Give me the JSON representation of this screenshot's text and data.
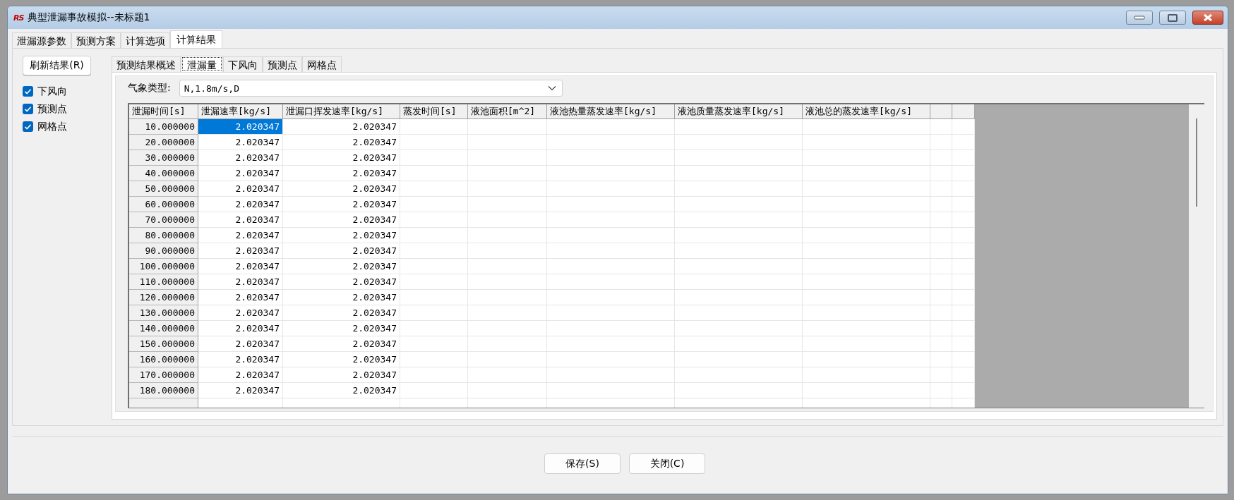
{
  "window": {
    "logo": "RS",
    "title": "典型泄漏事故模拟--未标题1"
  },
  "tabs": [
    {
      "label": "泄漏源参数",
      "selected": false
    },
    {
      "label": "预测方案",
      "selected": false
    },
    {
      "label": "计算选项",
      "selected": false
    },
    {
      "label": "计算结果",
      "selected": true
    }
  ],
  "sidebar": {
    "refresh_button": "刷新结果(R)",
    "items": [
      {
        "label": "下风向",
        "checked": true
      },
      {
        "label": "预测点",
        "checked": true
      },
      {
        "label": "网格点",
        "checked": true
      }
    ]
  },
  "result_tabs": [
    {
      "label": "预测结果概述",
      "selected": false
    },
    {
      "label": "泄漏量",
      "selected": true
    },
    {
      "label": "下风向",
      "selected": false
    },
    {
      "label": "预测点",
      "selected": false
    },
    {
      "label": "网格点",
      "selected": false
    }
  ],
  "weather": {
    "label": "气象类型:",
    "value": "N,1.8m/s,D"
  },
  "table": {
    "columns": [
      "泄漏时间[s]",
      "泄漏速率[kg/s]",
      "泄漏口挥发速率[kg/s]",
      "蒸发时间[s]",
      "液池面积[m^2]",
      "液池热量蒸发速率[kg/s]",
      "液池质量蒸发速率[kg/s]",
      "液池总的蒸发速率[kg/s]"
    ],
    "rows": [
      {
        "cells": [
          {
            "text": "10.000000",
            "selected": false
          },
          {
            "text": "2.020347",
            "selected": true
          },
          {
            "text": "2.020347",
            "selected": false
          }
        ]
      },
      {
        "cells": [
          {
            "text": "20.000000",
            "selected": false
          },
          {
            "text": "2.020347",
            "selected": false
          },
          {
            "text": "2.020347",
            "selected": false
          }
        ]
      },
      {
        "cells": [
          {
            "text": "30.000000",
            "selected": false
          },
          {
            "text": "2.020347",
            "selected": false
          },
          {
            "text": "2.020347",
            "selected": false
          }
        ]
      },
      {
        "cells": [
          {
            "text": "40.000000",
            "selected": false
          },
          {
            "text": "2.020347",
            "selected": false
          },
          {
            "text": "2.020347",
            "selected": false
          }
        ]
      },
      {
        "cells": [
          {
            "text": "50.000000",
            "selected": false
          },
          {
            "text": "2.020347",
            "selected": false
          },
          {
            "text": "2.020347",
            "selected": false
          }
        ]
      },
      {
        "cells": [
          {
            "text": "60.000000",
            "selected": false
          },
          {
            "text": "2.020347",
            "selected": false
          },
          {
            "text": "2.020347",
            "selected": false
          }
        ]
      },
      {
        "cells": [
          {
            "text": "70.000000",
            "selected": false
          },
          {
            "text": "2.020347",
            "selected": false
          },
          {
            "text": "2.020347",
            "selected": false
          }
        ]
      },
      {
        "cells": [
          {
            "text": "80.000000",
            "selected": false
          },
          {
            "text": "2.020347",
            "selected": false
          },
          {
            "text": "2.020347",
            "selected": false
          }
        ]
      },
      {
        "cells": [
          {
            "text": "90.000000",
            "selected": false
          },
          {
            "text": "2.020347",
            "selected": false
          },
          {
            "text": "2.020347",
            "selected": false
          }
        ]
      },
      {
        "cells": [
          {
            "text": "100.000000",
            "selected": false
          },
          {
            "text": "2.020347",
            "selected": false
          },
          {
            "text": "2.020347",
            "selected": false
          }
        ]
      },
      {
        "cells": [
          {
            "text": "110.000000",
            "selected": false
          },
          {
            "text": "2.020347",
            "selected": false
          },
          {
            "text": "2.020347",
            "selected": false
          }
        ]
      },
      {
        "cells": [
          {
            "text": "120.000000",
            "selected": false
          },
          {
            "text": "2.020347",
            "selected": false
          },
          {
            "text": "2.020347",
            "selected": false
          }
        ]
      },
      {
        "cells": [
          {
            "text": "130.000000",
            "selected": false
          },
          {
            "text": "2.020347",
            "selected": false
          },
          {
            "text": "2.020347",
            "selected": false
          }
        ]
      },
      {
        "cells": [
          {
            "text": "140.000000",
            "selected": false
          },
          {
            "text": "2.020347",
            "selected": false
          },
          {
            "text": "2.020347",
            "selected": false
          }
        ]
      },
      {
        "cells": [
          {
            "text": "150.000000",
            "selected": false
          },
          {
            "text": "2.020347",
            "selected": false
          },
          {
            "text": "2.020347",
            "selected": false
          }
        ]
      },
      {
        "cells": [
          {
            "text": "160.000000",
            "selected": false
          },
          {
            "text": "2.020347",
            "selected": false
          },
          {
            "text": "2.020347",
            "selected": false
          }
        ]
      },
      {
        "cells": [
          {
            "text": "170.000000",
            "selected": false
          },
          {
            "text": "2.020347",
            "selected": false
          },
          {
            "text": "2.020347",
            "selected": false
          }
        ]
      },
      {
        "cells": [
          {
            "text": "180.000000",
            "selected": false
          },
          {
            "text": "2.020347",
            "selected": false
          },
          {
            "text": "2.020347",
            "selected": false
          }
        ]
      }
    ]
  },
  "buttons": [
    "保存(S)",
    "关闭(C)"
  ]
}
